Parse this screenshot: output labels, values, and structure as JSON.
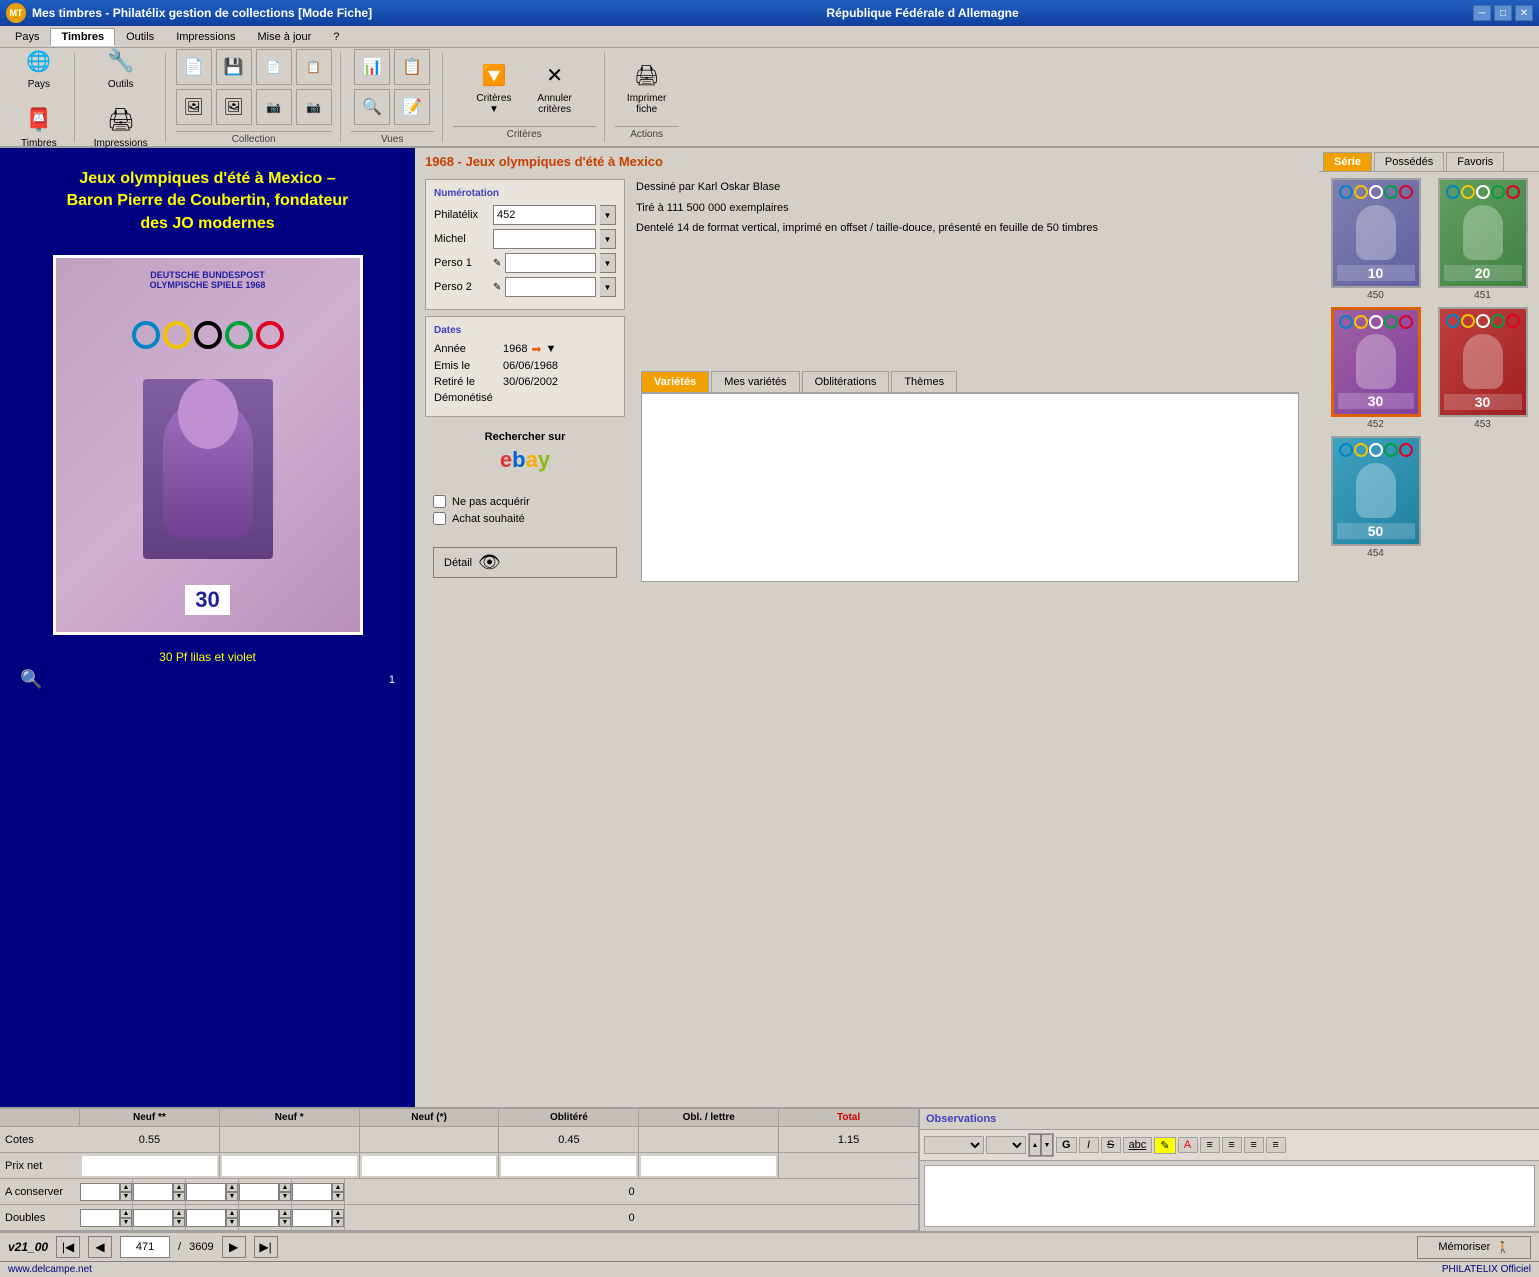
{
  "app": {
    "title": "Mes timbres - Philatélix gestion de collections [Mode Fiche]",
    "country": "République Fédérale d Allemagne",
    "logo": "MT",
    "website": "www.delcampe.net",
    "credits": "PHILATELIX Officiel",
    "version": "v21_00"
  },
  "menus": {
    "items": [
      "Pays",
      "Timbres",
      "Outils",
      "Impressions",
      "Mise à jour",
      "?"
    ],
    "active": "Timbres"
  },
  "toolbar": {
    "groups": [
      {
        "label": "",
        "buttons": [
          {
            "id": "pays",
            "label": "Pays",
            "icon": "🌐"
          },
          {
            "id": "timbres",
            "label": "Timbres",
            "icon": "📮"
          }
        ],
        "section": ""
      },
      {
        "label": "",
        "buttons": [],
        "section": "Collection"
      },
      {
        "label": "",
        "buttons": [],
        "section": "Vues"
      },
      {
        "label": "",
        "buttons": [
          {
            "id": "criteres",
            "label": "Critères",
            "icon": "🔽"
          },
          {
            "id": "annuler",
            "label": "Annuler critères",
            "icon": "✕"
          },
          {
            "id": "imprimer",
            "label": "Imprimer fiche",
            "icon": "🖨"
          }
        ],
        "section": "Critères"
      },
      {
        "label": "",
        "buttons": [],
        "section": "Actions"
      }
    ],
    "outils_label": "Outils",
    "impressions_label": "Impressions"
  },
  "stamp": {
    "title_line1": "Jeux olympiques d'été à Mexico –",
    "title_line2": "Baron Pierre de Coubertin, fondateur",
    "title_line3": "des JO modernes",
    "header_text": "DEUTSCHE BUNDESPOST",
    "subheader": "OLYMPISCHE SPIELE 1968",
    "value": "30",
    "caption": "30 Pf lilas et violet",
    "number": "1"
  },
  "stamp_info": {
    "title": "1968 - Jeux olympiques d'été à Mexico",
    "designer": "Dessiné par Karl Oskar Blase",
    "print_run": "Tiré à 111 500 000 exemplaires",
    "description": "Dentelé 14 de format vertical, imprimé en offset / taille-douce, présenté en feuille de 50 timbres"
  },
  "numbering": {
    "title": "Numérotation",
    "fields": [
      {
        "label": "Philatélix",
        "value": "452",
        "has_dropdown": true
      },
      {
        "label": "Michel",
        "value": "",
        "has_dropdown": true
      },
      {
        "label": "Perso 1",
        "value": "",
        "has_dropdown": true,
        "has_edit": true
      },
      {
        "label": "Perso 2",
        "value": "",
        "has_dropdown": true,
        "has_edit": true
      }
    ]
  },
  "dates": {
    "title": "Dates",
    "annee_label": "Année",
    "annee_value": "1968",
    "emis_label": "Emis le",
    "emis_value": "06/06/1968",
    "retire_label": "Retiré le",
    "retire_value": "30/06/2002",
    "demonetise_label": "Démonétisé"
  },
  "ebay": {
    "label": "Rechercher sur",
    "logo_e": "e",
    "logo_b": "b",
    "logo_a": "a",
    "logo_y": "y"
  },
  "checkboxes": [
    {
      "label": "Ne pas acquérir",
      "checked": false
    },
    {
      "label": "Achat souhaité",
      "checked": false
    }
  ],
  "detail_btn": "Détail",
  "variety_tabs": [
    "Variétés",
    "Mes variétés",
    "Oblitérations",
    "Thèmes"
  ],
  "active_variety_tab": "Variétés",
  "series_tabs": [
    "Série",
    "Possédés",
    "Favoris"
  ],
  "active_series_tab": "Série",
  "thumbnails": [
    {
      "num": "450",
      "color_class": "thumb-450",
      "value": "10"
    },
    {
      "num": "451",
      "color_class": "thumb-451",
      "value": "20"
    },
    {
      "num": "452",
      "color_class": "thumb-452",
      "value": "30",
      "selected": true
    },
    {
      "num": "453",
      "color_class": "thumb-453",
      "value": "30"
    },
    {
      "num": "454",
      "color_class": "thumb-454",
      "value": "50"
    }
  ],
  "price_table": {
    "headers": [
      "Neuf **",
      "Neuf *",
      "Neuf (*)",
      "Oblitéré",
      "Obl. / lettre",
      "Total"
    ],
    "rows": [
      {
        "label": "Cotes",
        "cells": [
          "0.55",
          "",
          "",
          "0.45",
          "",
          "1.15"
        ]
      },
      {
        "label": "Prix net",
        "cells": [
          "",
          "",
          "",
          "",
          "",
          ""
        ]
      },
      {
        "label": "A conserver",
        "cells": [
          "",
          "",
          "",
          "",
          "",
          "0"
        ]
      },
      {
        "label": "Doubles",
        "cells": [
          "",
          "",
          "",
          "",
          "",
          "0"
        ]
      }
    ]
  },
  "observations": {
    "title": "Observations",
    "toolbar_items": [
      "font-dropdown1",
      "font-dropdown2",
      "size-spinner",
      "bold-G",
      "italic-I",
      "strikethrough-S",
      "underline-abc",
      "highlight",
      "color-A",
      "align-left",
      "align-center",
      "align-right",
      "justify"
    ],
    "bold": "G",
    "italic": "I",
    "strikethrough": "S",
    "underline": "abc",
    "color": "A"
  },
  "navigation": {
    "current": "471",
    "total": "3609",
    "memoriser": "Mémoriser"
  },
  "status": {
    "version": "v21_00"
  }
}
